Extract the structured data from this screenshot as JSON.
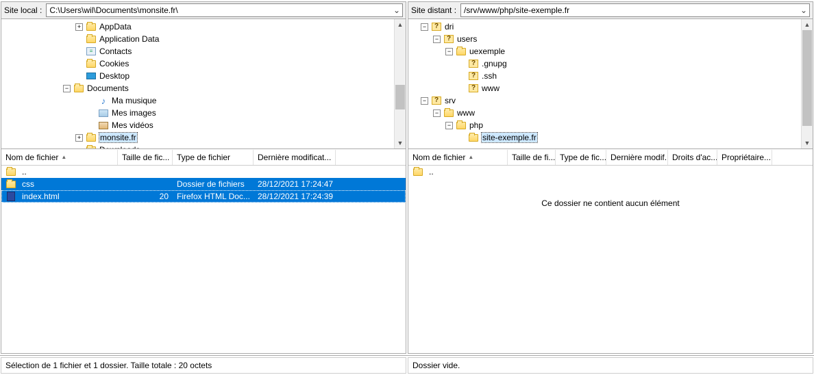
{
  "local": {
    "label": "Site local :",
    "path": "C:\\Users\\wil\\Documents\\monsite.fr\\",
    "tree": [
      {
        "indent": 6,
        "exp": "plus",
        "icon": "folder",
        "label": "AppData"
      },
      {
        "indent": 6,
        "exp": "none",
        "icon": "folder",
        "label": "Application Data"
      },
      {
        "indent": 6,
        "exp": "none",
        "icon": "contacts",
        "label": "Contacts"
      },
      {
        "indent": 6,
        "exp": "none",
        "icon": "folder",
        "label": "Cookies"
      },
      {
        "indent": 6,
        "exp": "none",
        "icon": "desktop",
        "label": "Desktop"
      },
      {
        "indent": 5,
        "exp": "minus",
        "icon": "folder",
        "label": "Documents"
      },
      {
        "indent": 7,
        "exp": "none",
        "icon": "music",
        "label": "Ma musique"
      },
      {
        "indent": 7,
        "exp": "none",
        "icon": "img",
        "label": "Mes images"
      },
      {
        "indent": 7,
        "exp": "none",
        "icon": "video",
        "label": "Mes vidéos"
      },
      {
        "indent": 6,
        "exp": "plus",
        "icon": "folder",
        "label": "monsite.fr",
        "selected": true
      },
      {
        "indent": 6,
        "exp": "none",
        "icon": "folder",
        "label": "Downloads"
      }
    ],
    "cols": {
      "name": "Nom de fichier",
      "size": "Taille de fic...",
      "type": "Type de fichier",
      "date": "Dernière modificat..."
    },
    "colw": {
      "name": 170,
      "size": 80,
      "type": 118,
      "date": 120
    },
    "rows": [
      {
        "icon": "folder",
        "name": "..",
        "size": "",
        "type": "",
        "date": ""
      },
      {
        "icon": "folder",
        "name": "css",
        "size": "",
        "type": "Dossier de fichiers",
        "date": "28/12/2021 17:24:47",
        "selected": true
      },
      {
        "icon": "html",
        "name": "index.html",
        "size": "20",
        "type": "Firefox HTML Doc...",
        "date": "28/12/2021 17:24:39",
        "selected": true,
        "focus": true
      }
    ],
    "status": "Sélection de 1 fichier et 1 dossier. Taille totale : 20 octets"
  },
  "remote": {
    "label": "Site distant :",
    "path": "/srv/www/php/site-exemple.fr",
    "tree": [
      {
        "indent": 1,
        "exp": "minus",
        "icon": "q",
        "label": "dri"
      },
      {
        "indent": 2,
        "exp": "minus",
        "icon": "q",
        "label": "users"
      },
      {
        "indent": 3,
        "exp": "minus",
        "icon": "folder",
        "label": "uexemple"
      },
      {
        "indent": 4,
        "exp": "none",
        "icon": "q",
        "label": ".gnupg"
      },
      {
        "indent": 4,
        "exp": "none",
        "icon": "q",
        "label": ".ssh"
      },
      {
        "indent": 4,
        "exp": "none",
        "icon": "q",
        "label": "www"
      },
      {
        "indent": 1,
        "exp": "minus",
        "icon": "q",
        "label": "srv"
      },
      {
        "indent": 2,
        "exp": "minus",
        "icon": "folder",
        "label": "www"
      },
      {
        "indent": 3,
        "exp": "minus",
        "icon": "folder",
        "label": "php"
      },
      {
        "indent": 4,
        "exp": "none",
        "icon": "folder",
        "label": "site-exemple.fr",
        "selected": true
      }
    ],
    "cols": {
      "name": "Nom de fichier",
      "size": "Taille de fi...",
      "type": "Type de fic...",
      "date": "Dernière modif...",
      "perm": "Droits d'ac...",
      "owner": "Propriétaire..."
    },
    "colw": {
      "name": 145,
      "size": 70,
      "type": 74,
      "date": 90,
      "perm": 72,
      "owner": 80
    },
    "rows": [
      {
        "icon": "folder",
        "name": "..",
        "size": "",
        "type": "",
        "date": "",
        "perm": "",
        "owner": ""
      }
    ],
    "empty": "Ce dossier ne contient aucun élément",
    "status": "Dossier vide."
  }
}
